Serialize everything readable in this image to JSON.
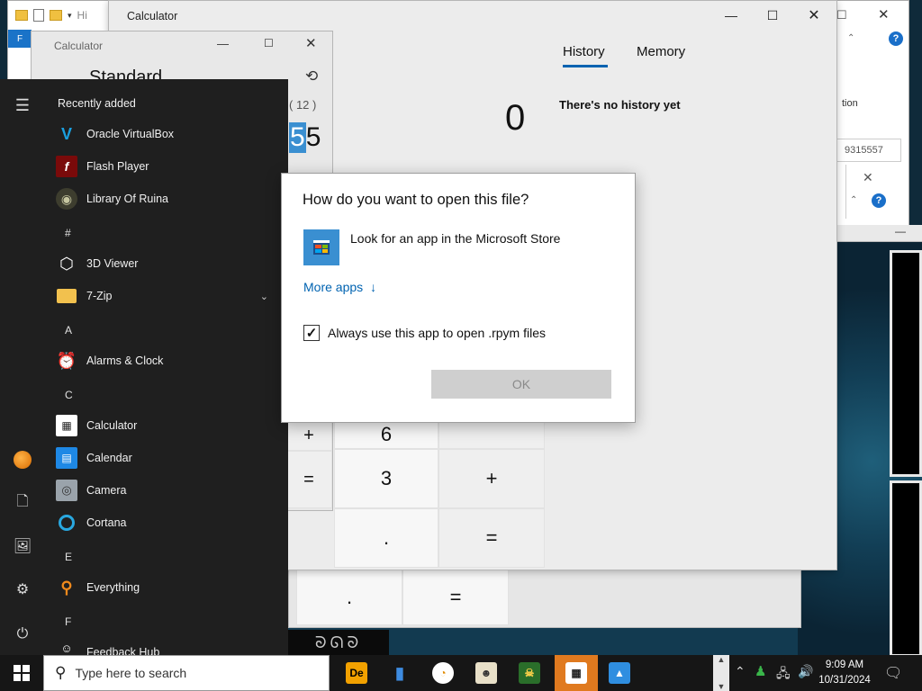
{
  "bg_window": {
    "address_text": "Hi",
    "tab_letter": "F",
    "ribbon_text": "tion",
    "field_value": "9315557"
  },
  "calc_main": {
    "title": "Calculator",
    "tabs": [
      "History",
      "Memory"
    ],
    "display": "0",
    "history_empty": "There's no history yet",
    "keys": [
      "6",
      "+",
      "3",
      "+",
      ".",
      "="
    ]
  },
  "calc_back": {
    "keys": [
      ".",
      "="
    ]
  },
  "calc_small": {
    "title": "Calculator",
    "mode": "Standard",
    "expression": "( 12 )",
    "display_tail": "5",
    "display_hl": "5",
    "side_keys": [
      "+",
      "="
    ]
  },
  "start_menu": {
    "section_recent": "Recently added",
    "apps": [
      {
        "label": "Oracle VirtualBox",
        "icon": "virtualbox-icon"
      },
      {
        "label": "Flash Player",
        "icon": "flash-icon"
      },
      {
        "label": "Library Of Ruina",
        "icon": "ruina-icon"
      },
      {
        "letter": "#"
      },
      {
        "label": "3D Viewer",
        "icon": "cube-icon"
      },
      {
        "label": "7-Zip",
        "icon": "folder-icon",
        "expandable": true
      },
      {
        "letter": "A"
      },
      {
        "label": "Alarms & Clock",
        "icon": "clock-icon"
      },
      {
        "letter": "C"
      },
      {
        "label": "Calculator",
        "icon": "calculator-icon"
      },
      {
        "label": "Calendar",
        "icon": "calendar-icon"
      },
      {
        "label": "Camera",
        "icon": "camera-icon"
      },
      {
        "label": "Cortana",
        "icon": "cortana-icon"
      },
      {
        "letter": "E"
      },
      {
        "label": "Everything",
        "icon": "search-icon"
      },
      {
        "letter": "F"
      },
      {
        "label": "Feedback Hub",
        "icon": "feedback-icon"
      }
    ]
  },
  "dialog": {
    "title": "How do you want to open this file?",
    "store_option": "Look for an app in the Microsoft Store",
    "more_apps": "More apps",
    "always_use": "Always use this app to open .rpym files",
    "always_checked": true,
    "ok": "OK"
  },
  "taskbar": {
    "search_placeholder": "Type here to search",
    "time": "9:09 AM",
    "date": "10/31/2024"
  },
  "colors": {
    "accent": "#0063b1",
    "start_bg": "#1f1f1f",
    "taskbar_bg": "#161616",
    "highlight": "#3a8fd1",
    "link": "#0063b1"
  }
}
